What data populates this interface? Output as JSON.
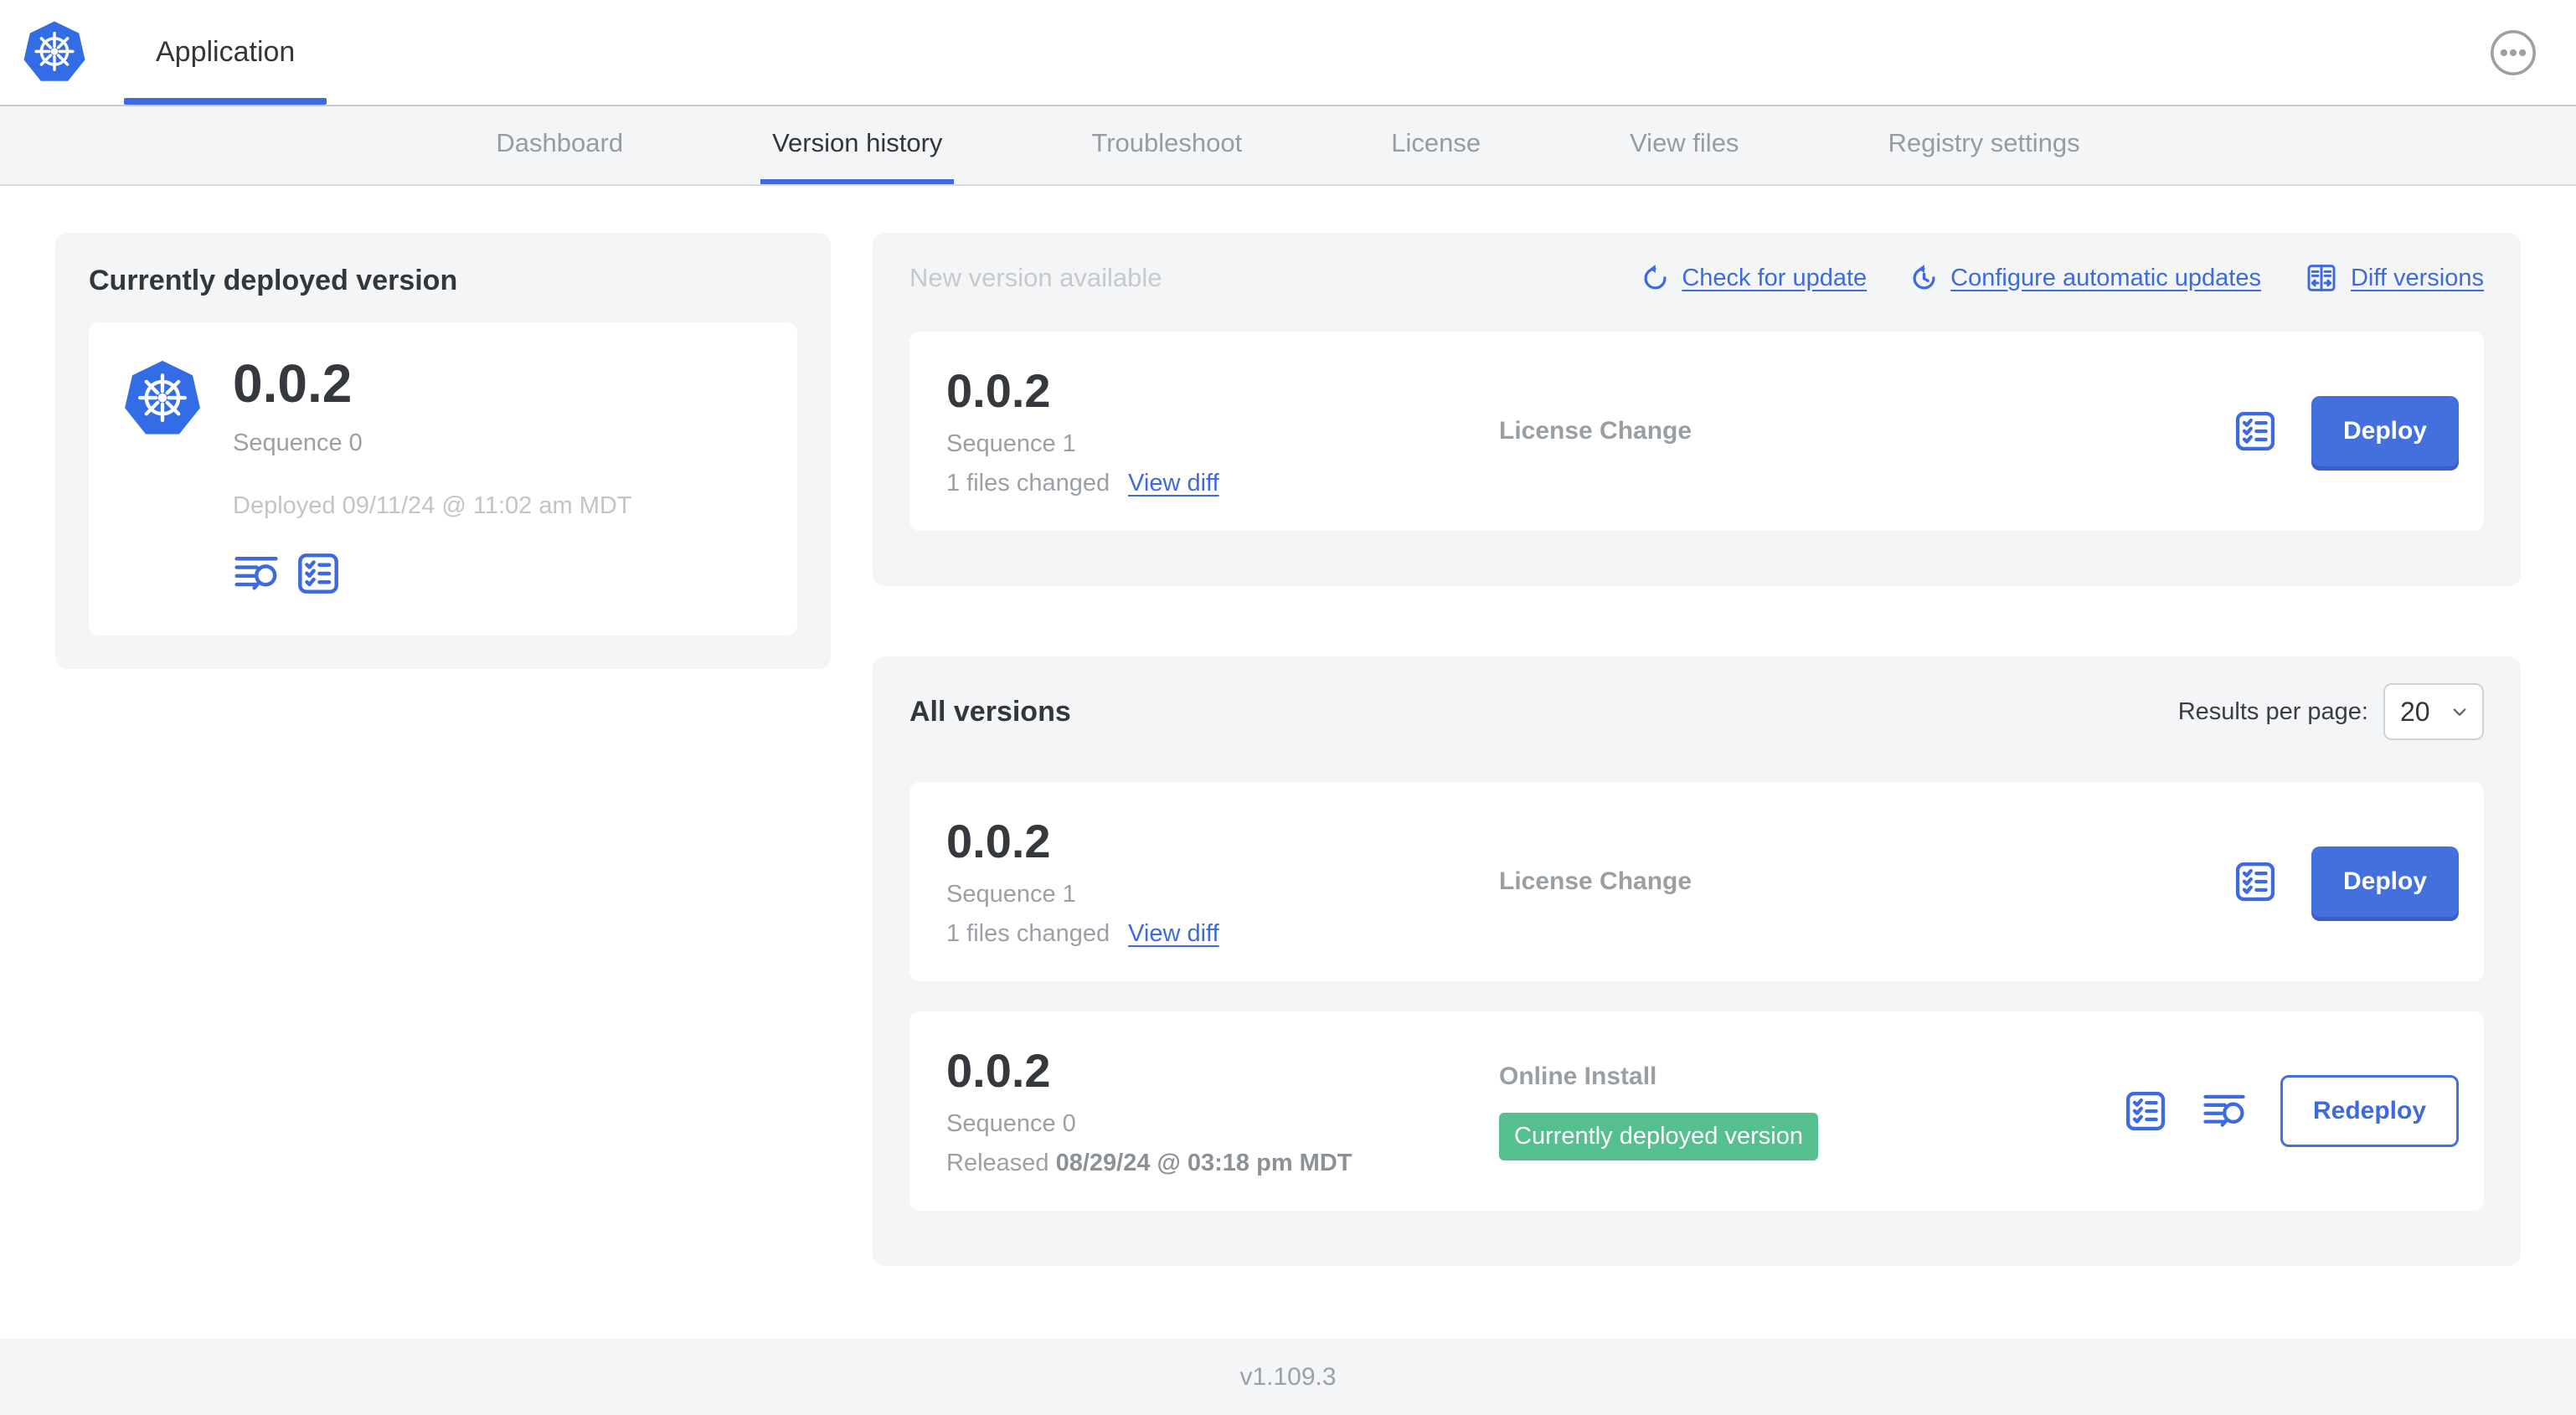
{
  "colors": {
    "primary_blue": "#3e6ae1",
    "button_blue": "#4470dd",
    "kubernetes_blue": "#326de6",
    "badge_green": "#56bf8f",
    "card_background": "#f4f5f7",
    "text_dark": "#33373a",
    "text_gray": "#9aa0a6",
    "text_light_gray": "#c6cacd"
  },
  "header": {
    "app_tab_label": "Application"
  },
  "nav": {
    "tabs": [
      {
        "label": "Dashboard",
        "active": false
      },
      {
        "label": "Version history",
        "active": true
      },
      {
        "label": "Troubleshoot",
        "active": false
      },
      {
        "label": "License",
        "active": false
      },
      {
        "label": "View files",
        "active": false
      },
      {
        "label": "Registry settings",
        "active": false
      }
    ]
  },
  "current_version_card": {
    "title": "Currently deployed version",
    "version": "0.0.2",
    "sequence": "Sequence 0",
    "deployed_text": "Deployed 09/11/24 @ 11:02 am MDT"
  },
  "new_version_card": {
    "title": "New version available",
    "actions": {
      "check_for_update": "Check for update",
      "configure_automatic_updates": "Configure automatic updates",
      "diff_versions": "Diff versions"
    },
    "row": {
      "version": "0.0.2",
      "sequence": "Sequence 1",
      "files_changed": "1 files changed",
      "view_diff_label": "View diff",
      "source": "License Change",
      "deploy_label": "Deploy"
    }
  },
  "all_versions_card": {
    "title": "All versions",
    "results_per_page_label": "Results per page:",
    "per_page_value": "20",
    "rows": [
      {
        "version": "0.0.2",
        "sequence": "Sequence 1",
        "files_changed": "1 files changed",
        "view_diff_label": "View diff",
        "source": "License Change",
        "action_label": "Deploy"
      },
      {
        "version": "0.0.2",
        "sequence": "Sequence 0",
        "released_prefix": "Released ",
        "released_date": "08/29/24 @ 03:18 pm MDT",
        "source": "Online Install",
        "badge": "Currently deployed version",
        "action_label": "Redeploy"
      }
    ]
  },
  "footer": {
    "version_label": "v1.109.3"
  }
}
